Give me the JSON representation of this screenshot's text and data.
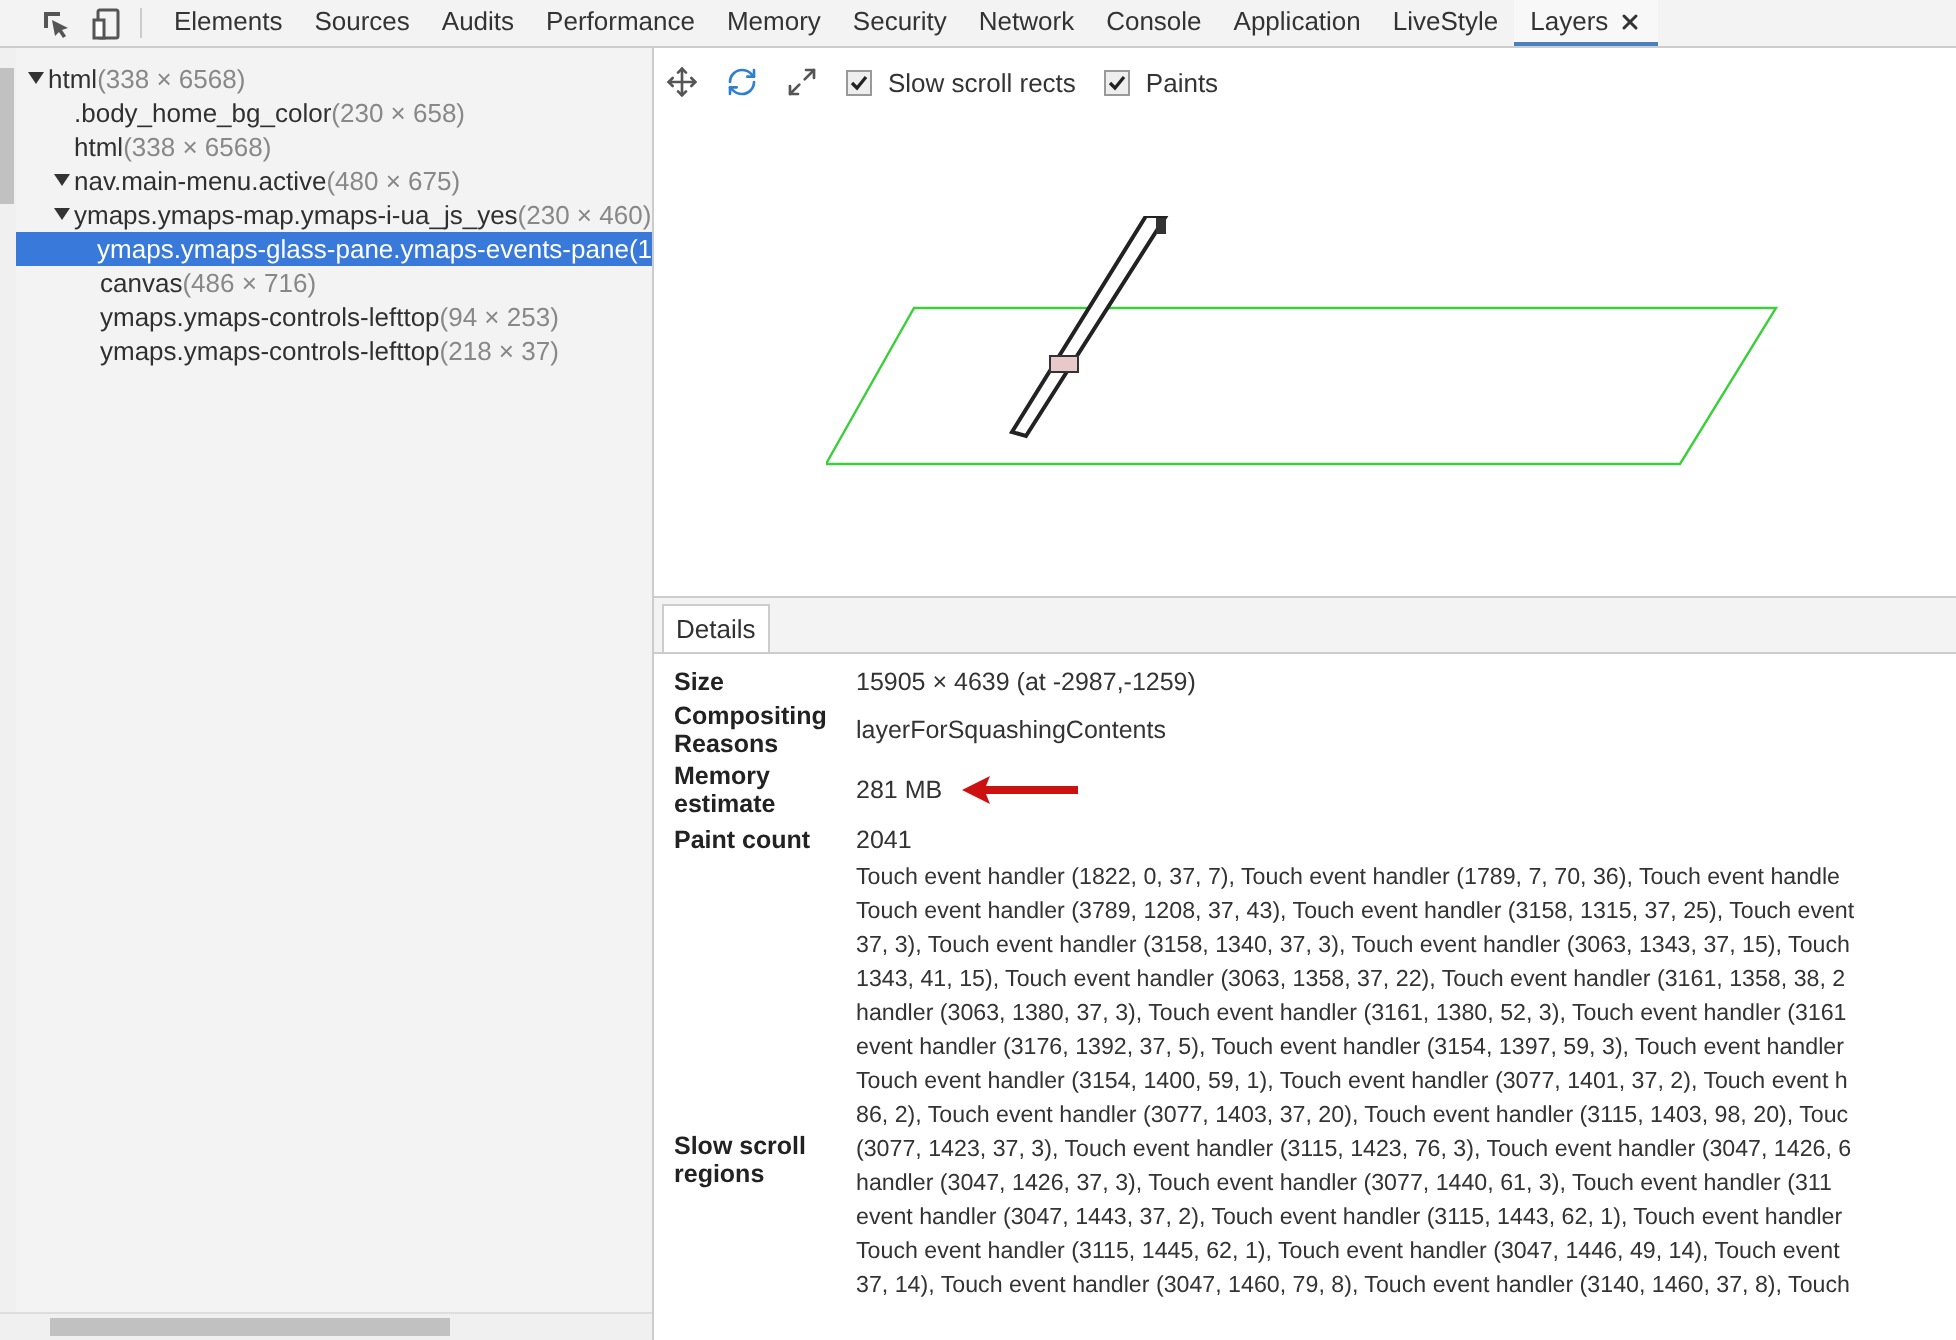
{
  "tabs": [
    {
      "label": "Elements",
      "selected": false,
      "closable": false
    },
    {
      "label": "Sources",
      "selected": false,
      "closable": false
    },
    {
      "label": "Audits",
      "selected": false,
      "closable": false
    },
    {
      "label": "Performance",
      "selected": false,
      "closable": false
    },
    {
      "label": "Memory",
      "selected": false,
      "closable": false
    },
    {
      "label": "Security",
      "selected": false,
      "closable": false
    },
    {
      "label": "Network",
      "selected": false,
      "closable": false
    },
    {
      "label": "Console",
      "selected": false,
      "closable": false
    },
    {
      "label": "Application",
      "selected": false,
      "closable": false
    },
    {
      "label": "LiveStyle",
      "selected": false,
      "closable": false
    },
    {
      "label": "Layers",
      "selected": true,
      "closable": true
    }
  ],
  "tree": [
    {
      "name": "html",
      "size": "(338 × 6568)",
      "expanded": true,
      "selected": false,
      "children": [
        {
          "name": ".body_home_bg_color",
          "size": "(230 × 658)",
          "selected": false
        },
        {
          "name": "html",
          "size": "(338 × 6568)",
          "selected": false
        },
        {
          "name": "nav.main-menu.active",
          "size": "(480 × 675)",
          "expanded": true,
          "selected": false
        },
        {
          "name": "ymaps.ymaps-map.ymaps-i-ua_js_yes",
          "size": "(230 × 460)",
          "expanded": true,
          "selected": false,
          "children": [
            {
              "name": "ymaps.ymaps-glass-pane.ymaps-events-pane",
              "size": "(1",
              "selected": true
            },
            {
              "name": "canvas",
              "size": "(486 × 716)",
              "selected": false
            },
            {
              "name": "ymaps.ymaps-controls-lefttop",
              "size": "(94 × 253)",
              "selected": false
            },
            {
              "name": "ymaps.ymaps-controls-lefttop",
              "size": "(218 × 37)",
              "selected": false
            }
          ]
        }
      ]
    }
  ],
  "layer_toolbar": {
    "modes": [
      {
        "kind": "pan",
        "selected": false
      },
      {
        "kind": "rotate",
        "selected": true
      },
      {
        "kind": "reset",
        "selected": false
      }
    ],
    "checkboxes": [
      {
        "label": "Slow scroll rects",
        "checked": true
      },
      {
        "label": "Paints",
        "checked": true
      }
    ]
  },
  "details_tabs": [
    {
      "label": "Details",
      "selected": true
    }
  ],
  "details": [
    {
      "label": "Size",
      "value": "15905 × 4639 (at -2987,-1259)",
      "arrow": false
    },
    {
      "label": "Compositing Reasons",
      "value": "layerForSquashingContents",
      "arrow": false
    },
    {
      "label": "Memory estimate",
      "value": "281 MB",
      "arrow": true
    },
    {
      "label": "Paint count",
      "value": "2041",
      "arrow": false
    }
  ],
  "slow_scroll": {
    "label": "Slow scroll regions",
    "lines": [
      "Touch event handler (1822, 0, 37, 7), Touch event handler (1789, 7, 70, 36), Touch event handle",
      "Touch event handler (3789, 1208, 37, 43), Touch event handler (3158, 1315, 37, 25), Touch event",
      "37, 3), Touch event handler (3158, 1340, 37, 3), Touch event handler (3063, 1343, 37, 15), Touch",
      "1343, 41, 15), Touch event handler (3063, 1358, 37, 22), Touch event handler (3161, 1358, 38, 2",
      "handler (3063, 1380, 37, 3), Touch event handler (3161, 1380, 52, 3), Touch event handler (3161",
      "event handler (3176, 1392, 37, 5), Touch event handler (3154, 1397, 59, 3), Touch event handler",
      "Touch event handler (3154, 1400, 59, 1), Touch event handler (3077, 1401, 37, 2), Touch event h",
      "86, 2), Touch event handler (3077, 1403, 37, 20), Touch event handler (3115, 1403, 98, 20), Touc",
      "(3077, 1423, 37, 3), Touch event handler (3115, 1423, 76, 3), Touch event handler (3047, 1426, 6",
      "handler (3047, 1426, 37, 3), Touch event handler (3077, 1440, 61, 3), Touch event handler (311",
      "event handler (3047, 1443, 37, 2), Touch event handler (3115, 1443, 62, 1), Touch event handler",
      "Touch event handler (3115, 1445, 62, 1), Touch event handler (3047, 1446, 49, 14), Touch event",
      "37, 14), Touch event handler (3047, 1460, 79, 8), Touch event handler (3140, 1460, 37, 8), Touch"
    ]
  }
}
